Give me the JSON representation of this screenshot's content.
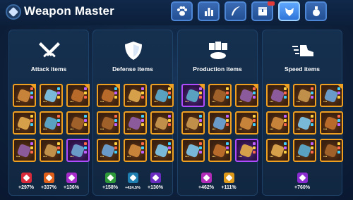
{
  "header": {
    "title": "Weapon Master",
    "tabs": [
      {
        "icon": "paw-icon",
        "active": false
      },
      {
        "icon": "bar-chart-icon",
        "active": false
      },
      {
        "icon": "feather-icon",
        "active": false
      },
      {
        "icon": "treasure-chest-icon",
        "active": false
      },
      {
        "icon": "wolf-head-icon",
        "active": true
      },
      {
        "icon": "potion-icon",
        "active": false
      }
    ]
  },
  "panels": [
    {
      "title": "Attack items",
      "icon": "crossed-swords-icon",
      "items": [
        "orange",
        "orange",
        "orange",
        "orange",
        "orange",
        "orange",
        "orange",
        "orange",
        "purple"
      ],
      "stats": [
        {
          "value": "+297%",
          "color": "#d82a3a",
          "icon": "attack-stat-icon"
        },
        {
          "value": "+337%",
          "color": "#e0601a",
          "icon": "fire-stat-icon"
        },
        {
          "value": "+136%",
          "color": "#a52cc8",
          "icon": "crit-stat-icon"
        }
      ]
    },
    {
      "title": "Defense items",
      "icon": "shield-icon",
      "items": [
        "orange",
        "orange",
        "orange",
        "orange",
        "orange",
        "orange",
        "orange",
        "orange",
        "orange"
      ],
      "stats": [
        {
          "value": "+158%",
          "color": "#2f9a3a",
          "icon": "heal-stat-icon"
        },
        {
          "value": "+424.5%",
          "color": "#1f7fb0",
          "icon": "defense-stat-icon",
          "small": true
        },
        {
          "value": "+130%",
          "color": "#6a2cc0",
          "icon": "resist-stat-icon"
        }
      ]
    },
    {
      "title": "Production items",
      "icon": "production-icon",
      "items": [
        "purple",
        "orange",
        "orange",
        "orange",
        "orange",
        "orange",
        "orange",
        "orange",
        "purple"
      ],
      "stats": [
        {
          "value": "+462%",
          "color": "#b02bb8",
          "icon": "production-stat-icon"
        },
        {
          "value": "+111%",
          "color": "#e09a1a",
          "icon": "gold-stat-icon"
        }
      ]
    },
    {
      "title": "Speed items",
      "icon": "running-shoe-icon",
      "items": [
        "orange",
        "orange",
        "orange",
        "orange",
        "orange",
        "orange",
        "orange",
        "orange",
        "orange"
      ],
      "stats": [
        {
          "value": "+760%",
          "color": "#8a2cd0",
          "icon": "speed-stat-icon"
        }
      ]
    }
  ]
}
